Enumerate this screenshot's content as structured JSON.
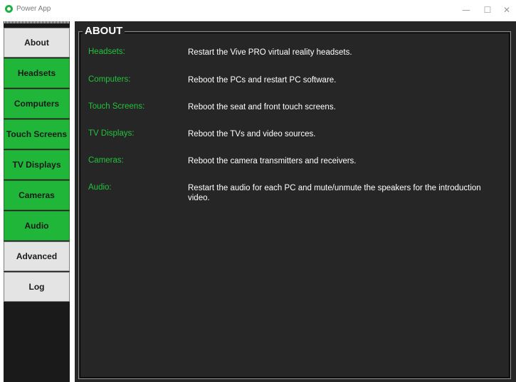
{
  "window": {
    "title": "Power App",
    "minimize": "—",
    "maximize": "☐",
    "close": "✕"
  },
  "sidebar": {
    "items": [
      {
        "label": "About",
        "style": "gray"
      },
      {
        "label": "Headsets",
        "style": "green"
      },
      {
        "label": "Computers",
        "style": "green"
      },
      {
        "label": "Touch Screens",
        "style": "green"
      },
      {
        "label": "TV Displays",
        "style": "green"
      },
      {
        "label": "Cameras",
        "style": "green"
      },
      {
        "label": "Audio",
        "style": "green"
      },
      {
        "label": "Advanced",
        "style": "gray"
      },
      {
        "label": "Log",
        "style": "gray"
      }
    ]
  },
  "about": {
    "title": "ABOUT",
    "rows": [
      {
        "label": "Headsets:",
        "desc": "Restart the Vive PRO virtual reality headsets."
      },
      {
        "label": "Computers:",
        "desc": "Reboot the PCs and restart PC software."
      },
      {
        "label": "Touch Screens:",
        "desc": "Reboot the seat and front touch screens."
      },
      {
        "label": "TV Displays:",
        "desc": "Reboot the TVs and video sources."
      },
      {
        "label": "Cameras:",
        "desc": "Reboot the camera transmitters and receivers."
      },
      {
        "label": "Audio:",
        "desc": "Restart the audio for each PC and mute/unmute the speakers for the introduction video."
      }
    ]
  },
  "colors": {
    "accent_green": "#20b63a",
    "label_green": "#22c33c",
    "panel_bg": "#262626",
    "sidebar_bg": "#1a1a1a"
  }
}
